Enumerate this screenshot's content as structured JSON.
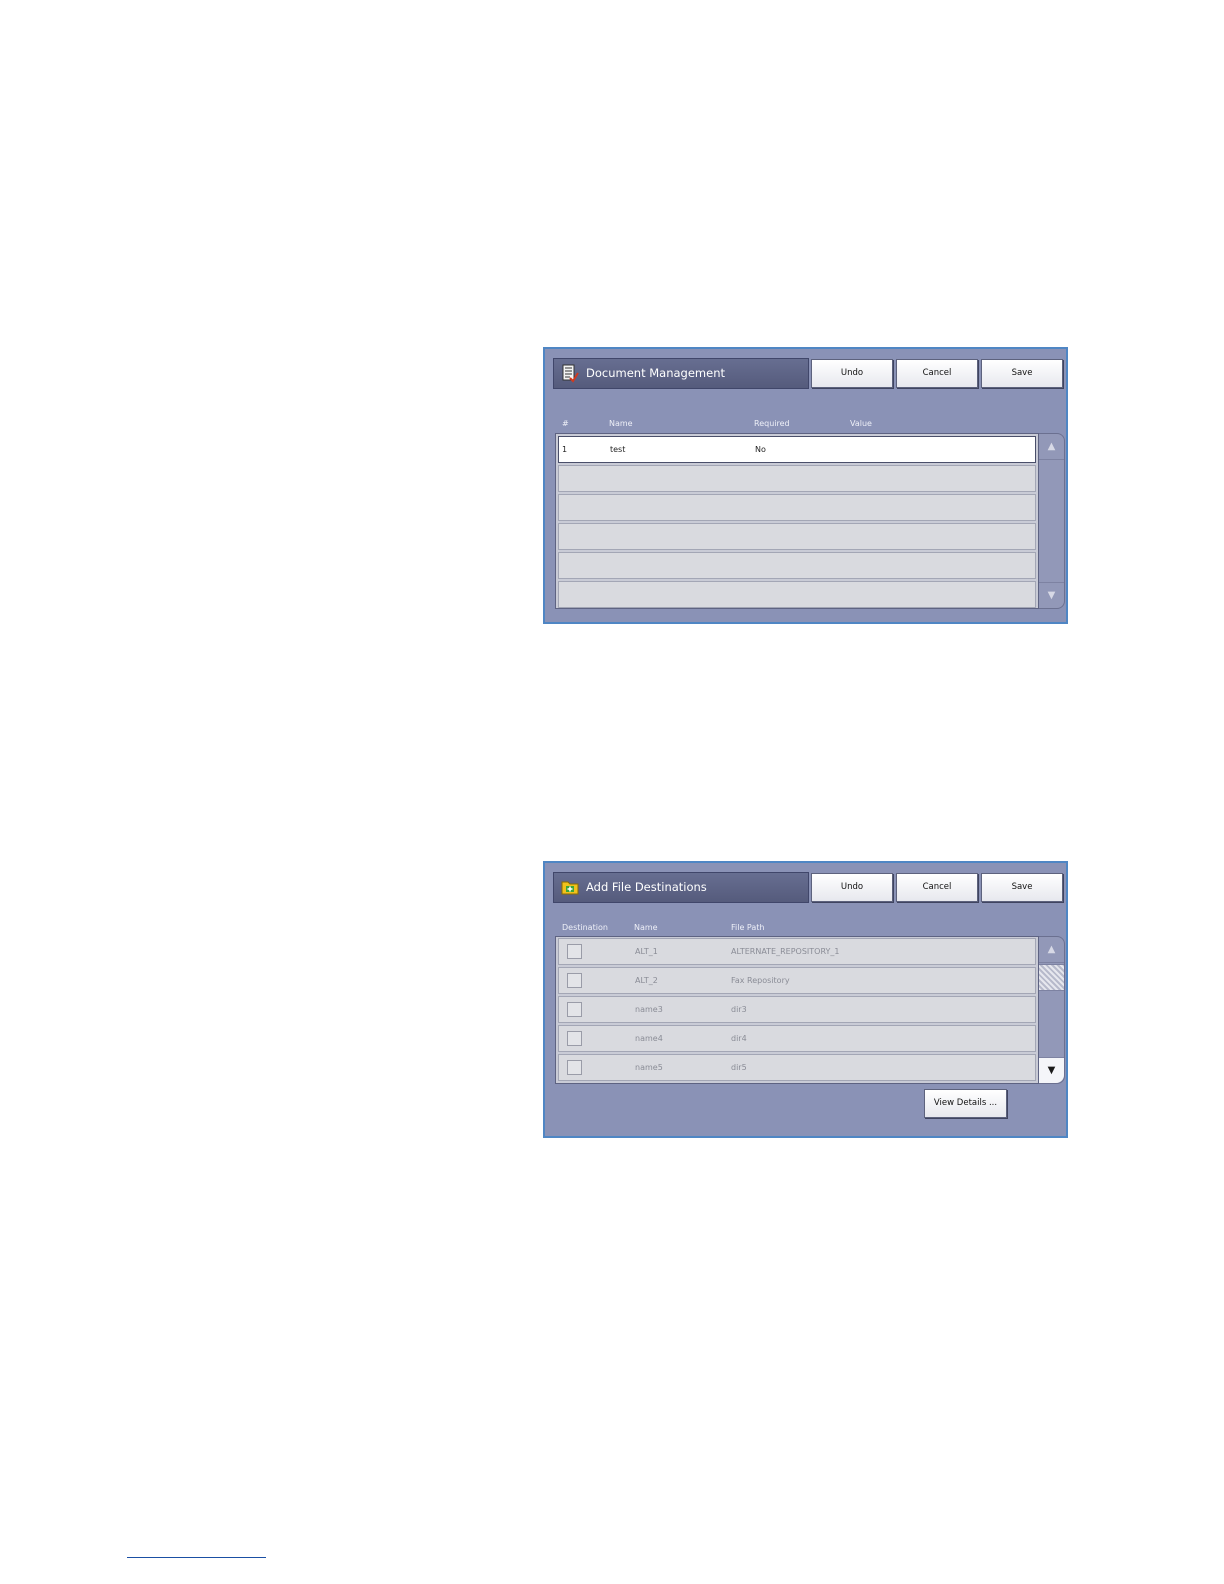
{
  "document_management": {
    "title": "Document Management",
    "icon": "document-checklist-icon",
    "buttons": {
      "undo": "Undo",
      "cancel": "Cancel",
      "save": "Save"
    },
    "columns": {
      "number": "#",
      "name": "Name",
      "required": "Required",
      "value": "Value"
    },
    "rows": [
      {
        "number": "1",
        "name": "test",
        "required": "No",
        "value": ""
      }
    ]
  },
  "add_file_destinations": {
    "title": "Add File Destinations",
    "icon": "folder-add-icon",
    "buttons": {
      "undo": "Undo",
      "cancel": "Cancel",
      "save": "Save"
    },
    "columns": {
      "destination": "Destination",
      "name": "Name",
      "file_path": "File Path"
    },
    "rows": [
      {
        "name": "ALT_1",
        "file_path": "ALTERNATE_REPOSITORY_1",
        "checked": false
      },
      {
        "name": "ALT_2",
        "file_path": "Fax Repository",
        "checked": false
      },
      {
        "name": "name3",
        "file_path": "dir3",
        "checked": false
      },
      {
        "name": "name4",
        "file_path": "dir4",
        "checked": false
      },
      {
        "name": "name5",
        "file_path": "dir5",
        "checked": false
      }
    ],
    "view_details_label": "View Details ..."
  },
  "colors": {
    "panel_background": "#8a92b6",
    "panel_border": "#4f86c4",
    "titlebar": "#5d6386",
    "row_background": "#d9dadf"
  }
}
